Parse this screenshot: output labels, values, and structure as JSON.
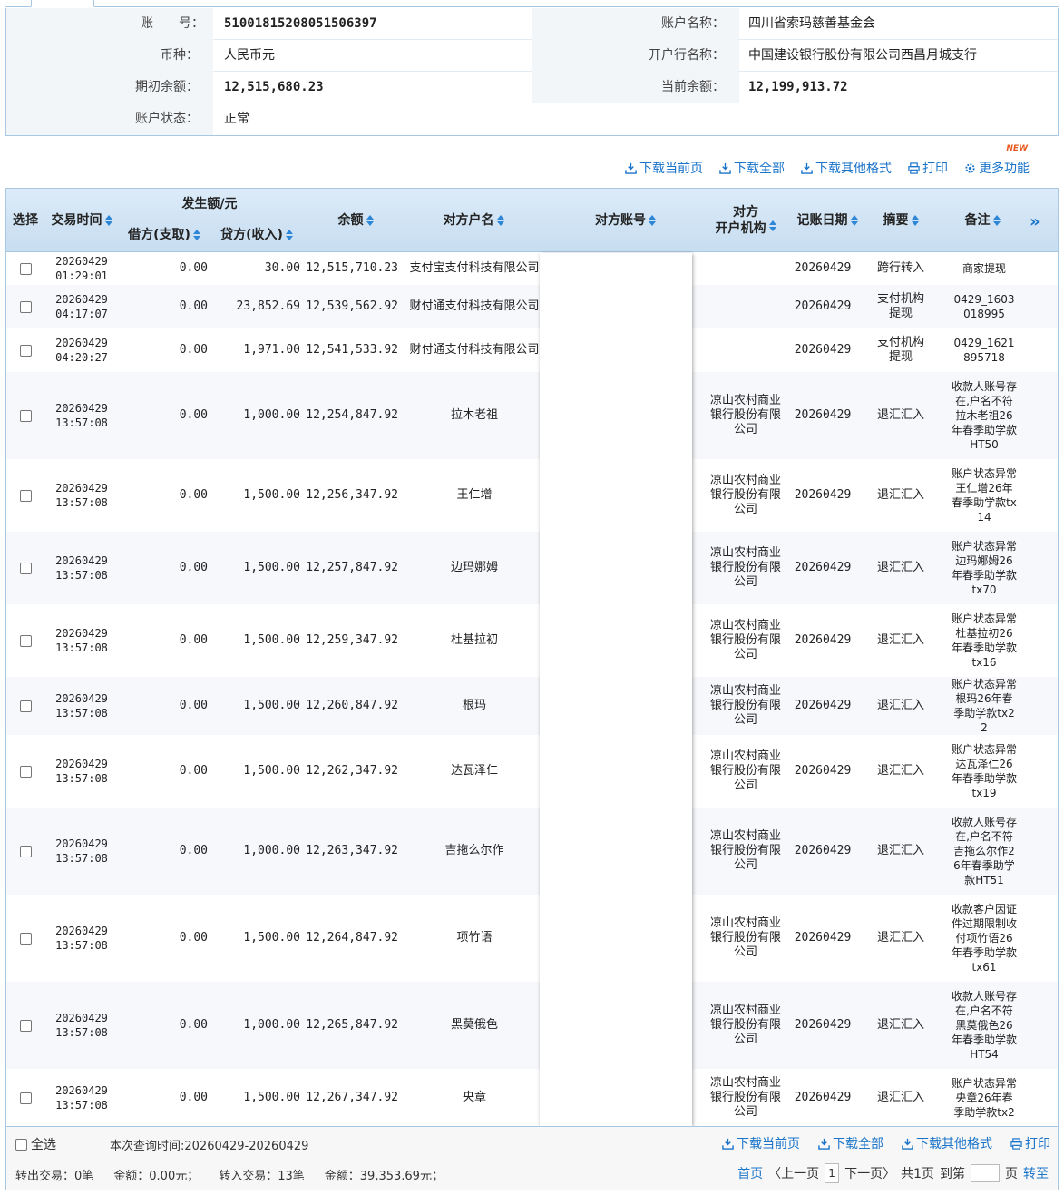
{
  "account": {
    "acct_no_label": "账　　号：",
    "acct_no": "51001815208051506397",
    "acct_name_label": "账户名称：",
    "acct_name": "四川省索玛慈善基金会",
    "currency_label": "币种：",
    "currency": "人民币元",
    "bank_label": "开户行名称：",
    "bank": "中国建设银行股份有限公司西昌月城支行",
    "open_bal_label": "期初余额：",
    "open_bal": "12,515,680.23",
    "cur_bal_label": "当前余额：",
    "cur_bal": "12,199,913.72",
    "status_label": "账户状态：",
    "status": "正常"
  },
  "toolbar": {
    "download_page": "下载当前页",
    "download_all": "下载全部",
    "download_other": "下载其他格式",
    "print": "打印",
    "more": "更多功能",
    "new_badge": "NEW"
  },
  "table": {
    "headers": {
      "select": "选择",
      "time": "交易时间",
      "amount_group": "发生额/元",
      "debit": "借方(支取)",
      "credit": "贷方(收入)",
      "balance": "余额",
      "cp_name": "对方户名",
      "cp_acct": "对方账号",
      "cp_bank_1": "对方",
      "cp_bank_2": "开户机构",
      "post_date": "记账日期",
      "summary": "摘要",
      "remark": "备注"
    },
    "rows": [
      {
        "d1": "20260429",
        "d2": "01:29:01",
        "debit": "0.00",
        "credit": "30.00",
        "balance": "12,515,710.23",
        "cp": "支付宝支付科技有限公司",
        "bank": "",
        "post": "20260429",
        "summary": "跨行转入",
        "remark": "商家提现"
      },
      {
        "d1": "20260429",
        "d2": "04:17:07",
        "debit": "0.00",
        "credit": "23,852.69",
        "balance": "12,539,562.92",
        "cp": "财付通支付科技有限公司",
        "bank": "",
        "post": "20260429",
        "summary": "支付机构提现",
        "remark": "0429_1603018995"
      },
      {
        "d1": "20260429",
        "d2": "04:20:27",
        "debit": "0.00",
        "credit": "1,971.00",
        "balance": "12,541,533.92",
        "cp": "财付通支付科技有限公司",
        "bank": "",
        "post": "20260429",
        "summary": "支付机构提现",
        "remark": "0429_1621895718"
      },
      {
        "d1": "20260429",
        "d2": "13:57:08",
        "debit": "0.00",
        "credit": "1,000.00",
        "balance": "12,254,847.92",
        "cp": "拉木老祖",
        "bank": "凉山农村商业银行股份有限公司",
        "post": "20260429",
        "summary": "退汇汇入",
        "remark": "收款人账号存在,户名不符拉木老祖26年春季助学款HT50"
      },
      {
        "d1": "20260429",
        "d2": "13:57:08",
        "debit": "0.00",
        "credit": "1,500.00",
        "balance": "12,256,347.92",
        "cp": "王仁增",
        "bank": "凉山农村商业银行股份有限公司",
        "post": "20260429",
        "summary": "退汇汇入",
        "remark": "账户状态异常王仁增26年春季助学款tx14"
      },
      {
        "d1": "20260429",
        "d2": "13:57:08",
        "debit": "0.00",
        "credit": "1,500.00",
        "balance": "12,257,847.92",
        "cp": "边玛娜姆",
        "bank": "凉山农村商业银行股份有限公司",
        "post": "20260429",
        "summary": "退汇汇入",
        "remark": "账户状态异常边玛娜姆26年春季助学款tx70"
      },
      {
        "d1": "20260429",
        "d2": "13:57:08",
        "debit": "0.00",
        "credit": "1,500.00",
        "balance": "12,259,347.92",
        "cp": "杜基拉初",
        "bank": "凉山农村商业银行股份有限公司",
        "post": "20260429",
        "summary": "退汇汇入",
        "remark": "账户状态异常杜基拉初26年春季助学款tx16"
      },
      {
        "d1": "20260429",
        "d2": "13:57:08",
        "debit": "0.00",
        "credit": "1,500.00",
        "balance": "12,260,847.92",
        "cp": "根玛",
        "bank": "凉山农村商业银行股份有限公司",
        "post": "20260429",
        "summary": "退汇汇入",
        "remark": "账户状态异常根玛26年春季助学款tx22"
      },
      {
        "d1": "20260429",
        "d2": "13:57:08",
        "debit": "0.00",
        "credit": "1,500.00",
        "balance": "12,262,347.92",
        "cp": "达瓦泽仁",
        "bank": "凉山农村商业银行股份有限公司",
        "post": "20260429",
        "summary": "退汇汇入",
        "remark": "账户状态异常达瓦泽仁26年春季助学款tx19"
      },
      {
        "d1": "20260429",
        "d2": "13:57:08",
        "debit": "0.00",
        "credit": "1,000.00",
        "balance": "12,263,347.92",
        "cp": "吉拖么尔作",
        "bank": "凉山农村商业银行股份有限公司",
        "post": "20260429",
        "summary": "退汇汇入",
        "remark": "收款人账号存在,户名不符吉拖么尔作26年春季助学款HT51"
      },
      {
        "d1": "20260429",
        "d2": "13:57:08",
        "debit": "0.00",
        "credit": "1,500.00",
        "balance": "12,264,847.92",
        "cp": "项竹语",
        "bank": "凉山农村商业银行股份有限公司",
        "post": "20260429",
        "summary": "退汇汇入",
        "remark": "收款客户因证件过期限制收付项竹语26年春季助学款tx61"
      },
      {
        "d1": "20260429",
        "d2": "13:57:08",
        "debit": "0.00",
        "credit": "1,000.00",
        "balance": "12,265,847.92",
        "cp": "黑莫俄色",
        "bank": "凉山农村商业银行股份有限公司",
        "post": "20260429",
        "summary": "退汇汇入",
        "remark": "收款人账号存在,户名不符黑莫俄色26年春季助学款HT54"
      },
      {
        "d1": "20260429",
        "d2": "13:57:08",
        "debit": "0.00",
        "credit": "1,500.00",
        "balance": "12,267,347.92",
        "cp": "央章",
        "bank": "凉山农村商业银行股份有限公司",
        "post": "20260429",
        "summary": "退汇汇入",
        "remark": "账户状态异常央章26年春季助学款tx2"
      }
    ]
  },
  "footer": {
    "select_all": "全选",
    "query_time": "本次查询时间:20260429-20260429",
    "download_page": "下载当前页",
    "download_all": "下载全部",
    "download_other": "下载其他格式",
    "print": "打印",
    "out_count": "转出交易：0笔",
    "out_amount": "金额：0.00元；",
    "in_count": "转入交易：13笔",
    "in_amount": "金额：39,353.69元；",
    "first": "首页",
    "prev": "〈上一页",
    "page": "1",
    "next": "下一页〉",
    "total": "共1页",
    "goto_label": "到第",
    "page_unit": "页",
    "go": "转至"
  }
}
